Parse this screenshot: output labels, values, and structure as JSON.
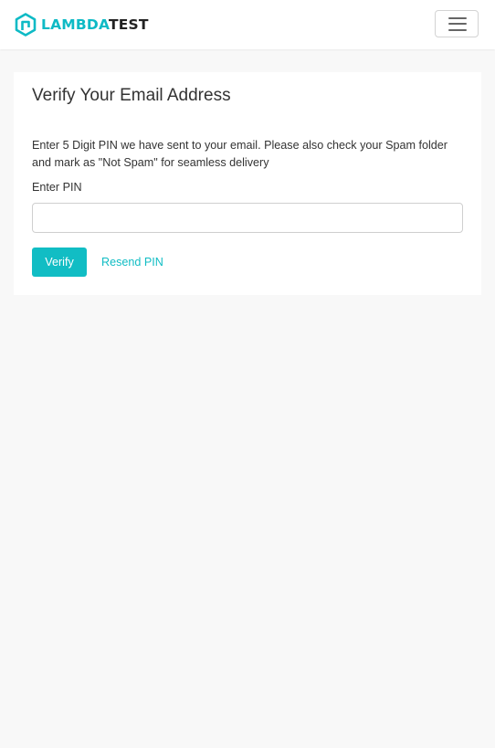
{
  "brand": {
    "name_part1": "LAMBDA",
    "name_part2": "TEST",
    "accent_color": "#0ebac5",
    "dark_color": "#222222",
    "logo_icon": "lambdatest-logo-icon"
  },
  "navbar": {
    "menu_icon": "hamburger-menu-icon"
  },
  "verify": {
    "title": "Verify Your Email Address",
    "description": "Enter 5 Digit PIN we have sent to your email. Please also check your Spam folder and mark as \"Not Spam\" for seamless delivery",
    "pin_label": "Enter PIN",
    "pin_value": "",
    "pin_placeholder": "",
    "verify_label": "Verify",
    "resend_label": "Resend PIN",
    "button_color": "#11bdc4"
  }
}
